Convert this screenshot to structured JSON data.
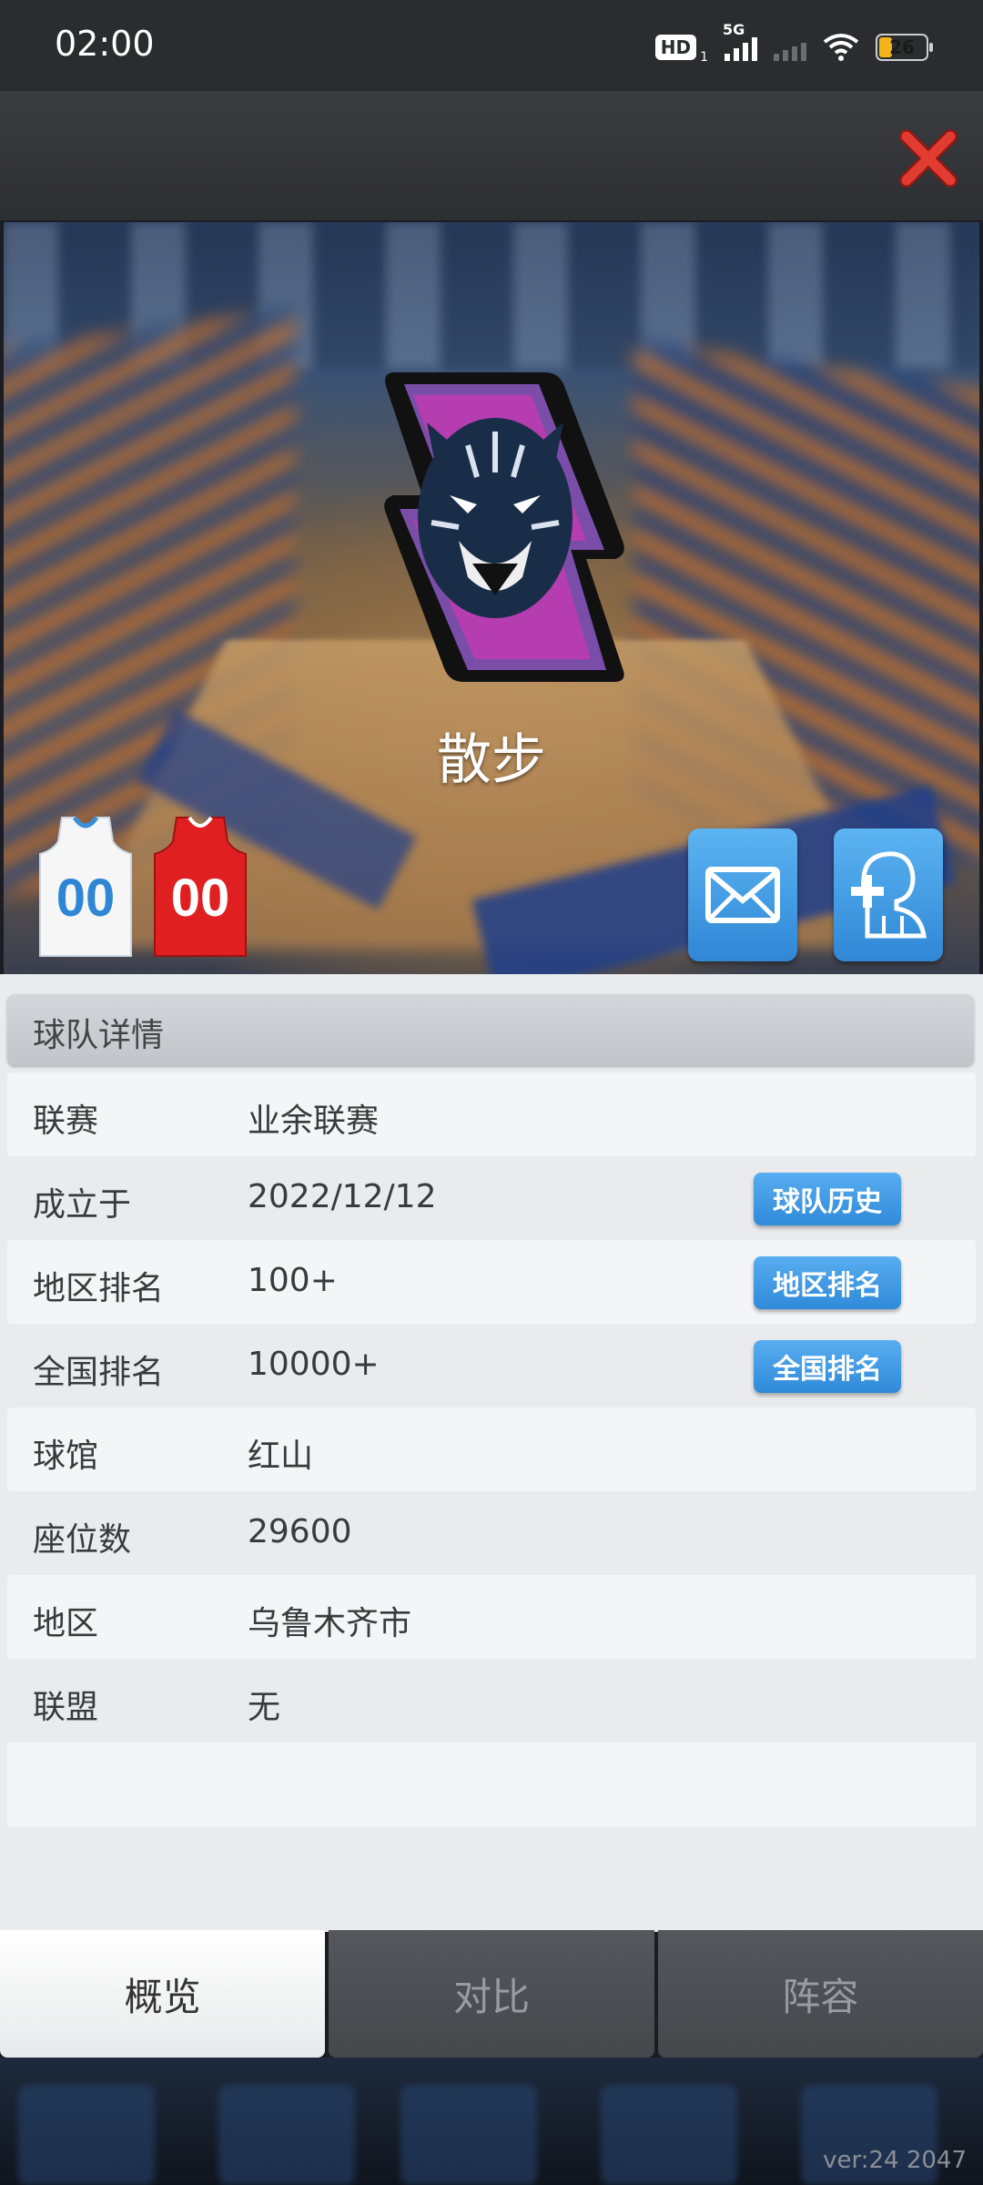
{
  "status_bar": {
    "time": "02:00",
    "hd_label": "HD",
    "hd_sub": "1",
    "network": "5G",
    "battery": "26"
  },
  "header": {
    "close_icon": "close-x-icon",
    "close_color": "#e23b30"
  },
  "hero": {
    "team_name": "散步",
    "home_jersey_number": "00",
    "away_jersey_number": "00",
    "home_jersey_color": "#ffffff",
    "away_jersey_color": "#e02020",
    "mail_icon": "mail-icon",
    "add_friend_icon": "add-friend-icon"
  },
  "details": {
    "section_title": "球队详情",
    "rows": [
      {
        "label": "联赛",
        "value": "业余联赛"
      },
      {
        "label": "成立于",
        "value": "2022/12/12",
        "action": "球队历史"
      },
      {
        "label": "地区排名",
        "value": "100+",
        "action": "地区排名"
      },
      {
        "label": "全国排名",
        "value": "10000+",
        "action": "全国排名"
      },
      {
        "label": "球馆",
        "value": "红山"
      },
      {
        "label": "座位数",
        "value": "29600"
      },
      {
        "label": "地区",
        "value": "乌鲁木齐市"
      },
      {
        "label": "联盟",
        "value": "无"
      }
    ]
  },
  "tabs": [
    {
      "label": "概览",
      "active": true
    },
    {
      "label": "对比",
      "active": false
    },
    {
      "label": "阵容",
      "active": false
    }
  ],
  "footer": {
    "version": "ver:24 2047"
  },
  "colors": {
    "accent_button": "#3a93dd",
    "panel_bg": "#e9ebed"
  }
}
